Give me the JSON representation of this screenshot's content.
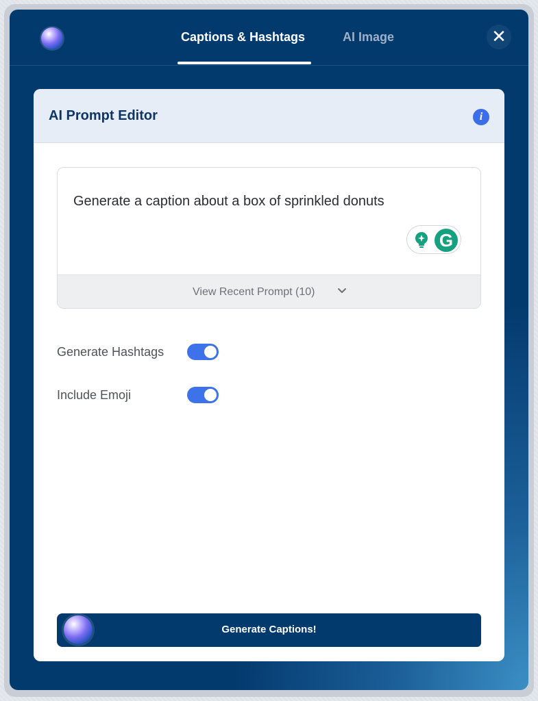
{
  "header": {
    "tabs": [
      {
        "label": "Captions & Hashtags",
        "active": true
      },
      {
        "label": "AI Image",
        "active": false
      }
    ],
    "close_glyph": "✕"
  },
  "editor": {
    "title": "AI Prompt Editor",
    "info_glyph": "i",
    "prompt_text": "Generate a caption about a box of sprinkled donuts",
    "recent_prompt_label": "View Recent Prompt (10)",
    "grammarly_glyph": "G"
  },
  "options": [
    {
      "label": "Generate Hashtags",
      "enabled": true
    },
    {
      "label": "Include Emoji",
      "enabled": true
    }
  ],
  "generate_button": {
    "label": "Generate Captions!"
  },
  "colors": {
    "window_bg": "#033a6e",
    "toggle_on": "#3d72ea",
    "grammarly": "#15a180",
    "info": "#3b6ee8"
  },
  "icons": [
    "ai-orb-icon",
    "close-icon",
    "info-icon",
    "bulb-icon",
    "grammarly-icon",
    "chevron-down-icon"
  ]
}
